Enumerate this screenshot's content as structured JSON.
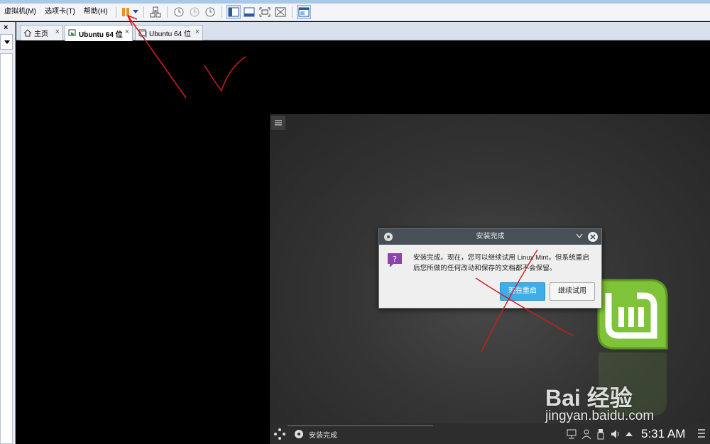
{
  "menubar": {
    "items": [
      "虚拟机(M)",
      "选项卡(T)",
      "帮助(H)"
    ]
  },
  "left_panel": {
    "close": "×"
  },
  "tabs": [
    {
      "label": "主页",
      "close": "×"
    },
    {
      "label": "Ubuntu 64 位",
      "close": "×"
    },
    {
      "label": "Ubuntu 64 位",
      "close": "×"
    }
  ],
  "dialog": {
    "title": "安装完成",
    "message_line1": "安装完成。现在，您可以继续试用 Linux Mint，但系统重启",
    "message_line2": "后您所做的任何改动和保存的文档都不会保留。",
    "restart_label": "现在重启",
    "continue_label": "继续试用"
  },
  "taskbar": {
    "app_label": "安装完成",
    "clock": "5:31 AM"
  },
  "watermark": {
    "brand": "Bai 经验",
    "url": "jingyan.baidu.com"
  },
  "colors": {
    "accent_blue": "#3daee9",
    "mint_green": "#87cf3e",
    "annotation_red": "#d11c1c"
  }
}
